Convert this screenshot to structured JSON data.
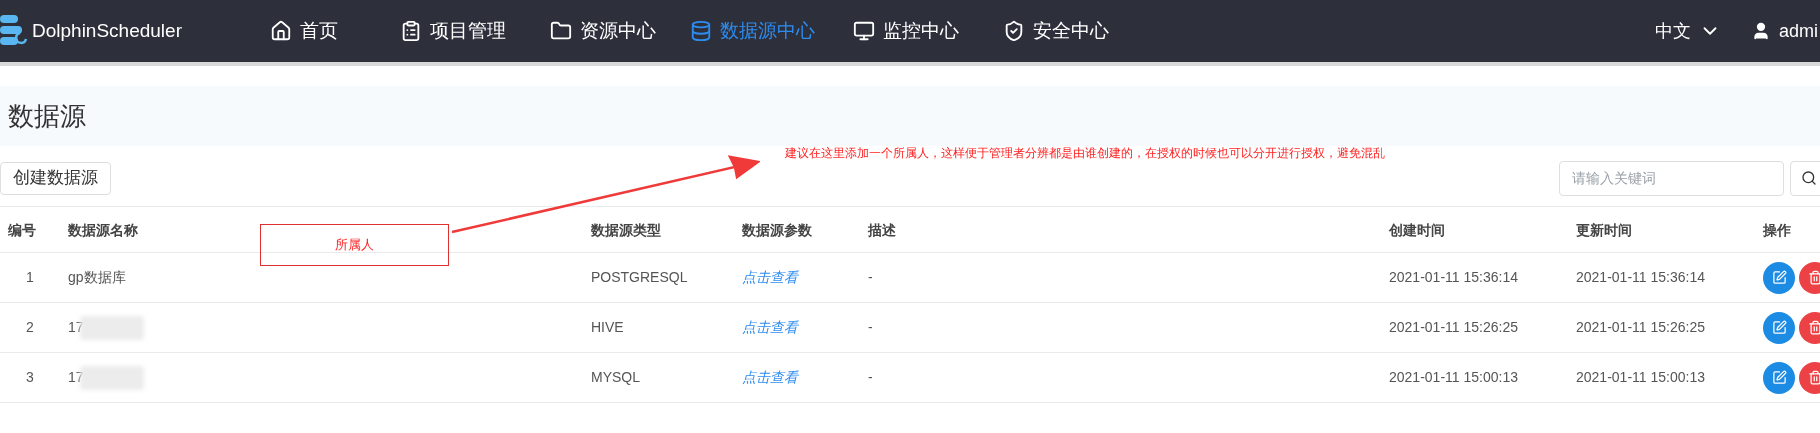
{
  "header": {
    "logo": "DolphinScheduler",
    "nav": [
      {
        "label": "首页",
        "kind": "home",
        "selected": false
      },
      {
        "label": "项目管理",
        "kind": "project",
        "selected": false
      },
      {
        "label": "资源中心",
        "kind": "folder",
        "selected": false
      },
      {
        "label": "数据源中心",
        "kind": "database",
        "selected": true
      },
      {
        "label": "监控中心",
        "kind": "monitor",
        "selected": false
      },
      {
        "label": "安全中心",
        "kind": "shield",
        "selected": false
      }
    ],
    "language": "中文",
    "user": "admi"
  },
  "page": {
    "title": "数据源",
    "create_button": "创建数据源",
    "search": {
      "placeholder": "请输入关键词"
    }
  },
  "annotation": {
    "note": "建议在这里添加一个所属人，这样便于管理者分辨都是由谁创建的，在授权的时候也可以分开进行授权，避免混乱",
    "box_label": "所属人"
  },
  "table": {
    "columns": [
      "编号",
      "数据源名称",
      "数据源类型",
      "数据源参数",
      "描述",
      "创建时间",
      "更新时间",
      "操作"
    ],
    "rows": [
      {
        "index": "1",
        "name": "gp数据库",
        "redacted": false,
        "type": "POSTGRESQL",
        "params": "点击查看",
        "description": "-",
        "created": "2021-01-11 15:36:14",
        "updated": "2021-01-11 15:36:14"
      },
      {
        "index": "2",
        "name": "17",
        "redacted": true,
        "type": "HIVE",
        "params": "点击查看",
        "description": "-",
        "created": "2021-01-11 15:26:25",
        "updated": "2021-01-11 15:26:25"
      },
      {
        "index": "3",
        "name": "17",
        "redacted": true,
        "type": "MYSQL",
        "params": "点击查看",
        "description": "-",
        "created": "2021-01-11 15:00:13",
        "updated": "2021-01-11 15:00:13"
      }
    ]
  }
}
